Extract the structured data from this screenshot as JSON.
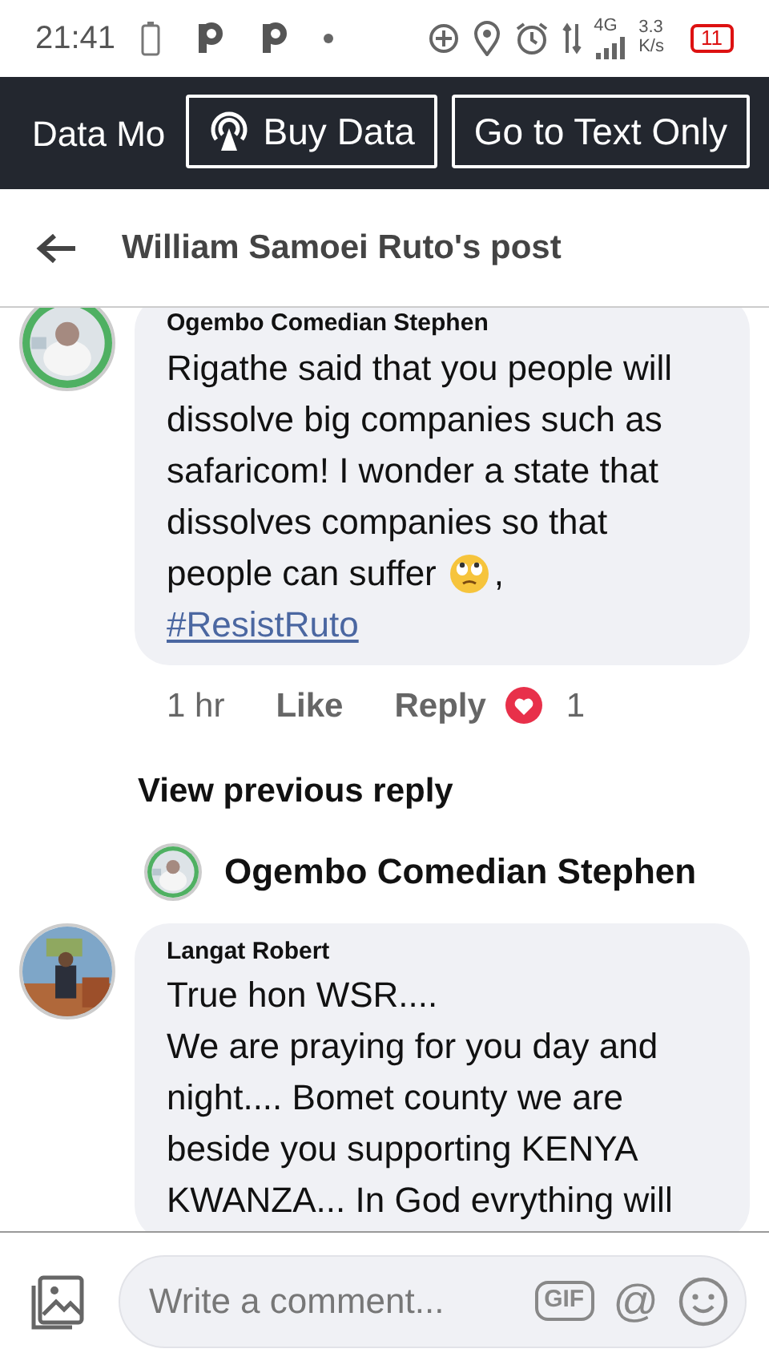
{
  "status_bar": {
    "time": "21:41",
    "network": "4G",
    "speed_value": "3.3",
    "speed_unit": "K/s",
    "battery": "11"
  },
  "data_bar": {
    "label": "Data Mo",
    "buttons": [
      {
        "label": "Buy Data",
        "kind": "icon"
      },
      {
        "label": "Go to Text Only",
        "kind": "plain"
      }
    ]
  },
  "header": {
    "title": "William Samoei Ruto's post"
  },
  "comments": [
    {
      "author": "Ogembo Comedian Stephen",
      "text": "Rigathe said that you people will dissolve big companies such as safaricom! I wonder a state that dissolves companies so that",
      "text_end": "people can suffer",
      "emoji": true,
      "text_after": ",",
      "hashtag": "#ResistRuto",
      "time": "1 hr",
      "like": "Like",
      "reply": "Reply",
      "reactions": "1"
    },
    {
      "author": "Langat Robert",
      "text": "True hon WSR....\nWe are praying for you day and night.... Bomet county we are beside you supporting KENYA KWANZA... In God evrything will"
    }
  ],
  "view_previous": "View previous reply",
  "reply_preview": {
    "author": "Ogembo Comedian Stephen"
  },
  "composer": {
    "placeholder": "Write a comment...",
    "gif": "GIF",
    "mention": "@"
  }
}
